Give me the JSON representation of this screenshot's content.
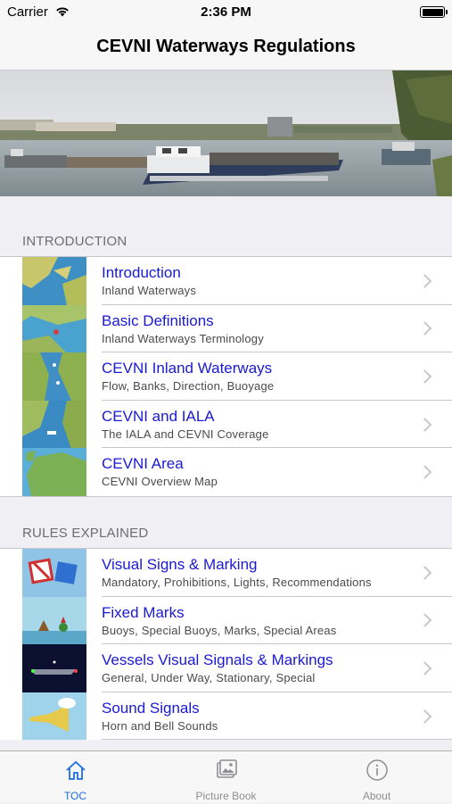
{
  "status_bar": {
    "carrier": "Carrier",
    "time": "2:36 PM"
  },
  "nav": {
    "title": "CEVNI Waterways Regulations"
  },
  "colors": {
    "link_blue": "#1919d6",
    "tab_active": "#1a6fe0",
    "tab_inactive": "#8e8e93",
    "background": "#efeff4"
  },
  "sections": [
    {
      "header": "INTRODUCTION",
      "items": [
        {
          "title": "Introduction",
          "subtitle": "Inland Waterways",
          "icon": "map-thumbnail-icon"
        },
        {
          "title": "Basic Definitions",
          "subtitle": "Inland Waterways Terminology",
          "icon": "map-thumbnail-icon"
        },
        {
          "title": "CEVNI Inland Waterways",
          "subtitle": "Flow, Banks, Direction, Buoyage",
          "icon": "map-thumbnail-icon"
        },
        {
          "title": "CEVNI and IALA",
          "subtitle": "The IALA and CEVNI Coverage",
          "icon": "map-thumbnail-icon"
        },
        {
          "title": "CEVNI Area",
          "subtitle": "CEVNI Overview Map",
          "icon": "europe-map-icon"
        }
      ]
    },
    {
      "header": "RULES EXPLAINED",
      "items": [
        {
          "title": "Visual Signs & Marking",
          "subtitle": "Mandatory, Prohibitions, Lights, Recommendations",
          "icon": "signs-icon"
        },
        {
          "title": "Fixed Marks",
          "subtitle": "Buoys, Special Buoys, Marks, Special Areas",
          "icon": "buoys-icon"
        },
        {
          "title": "Vessels Visual Signals & Markings",
          "subtitle": "General, Under Way, Stationary, Special",
          "icon": "vessel-lights-icon"
        },
        {
          "title": "Sound Signals",
          "subtitle": "Horn and Bell Sounds",
          "icon": "horn-icon"
        }
      ]
    }
  ],
  "tabs": [
    {
      "label": "TOC",
      "icon": "home-icon",
      "active": true
    },
    {
      "label": "Picture Book",
      "icon": "picture-book-icon",
      "active": false
    },
    {
      "label": "About",
      "icon": "info-icon",
      "active": false
    }
  ]
}
